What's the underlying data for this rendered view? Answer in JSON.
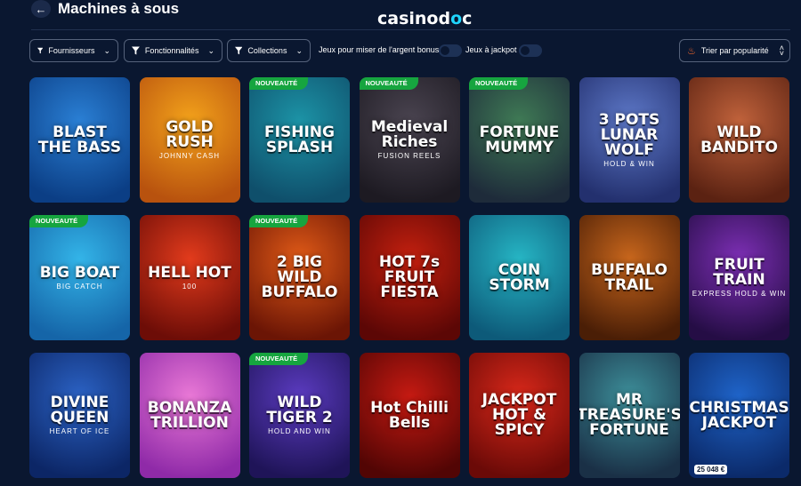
{
  "header": {
    "back_icon": "arrow-left-icon",
    "title": "Machines à sous",
    "logo_prefix": "casinod",
    "logo_o": "o",
    "logo_suffix": "c"
  },
  "filters": {
    "providers": "Fournisseurs",
    "features": "Fonctionnalités",
    "collections": "Collections",
    "bonus_toggle_label": "Jeux pour miser de l'argent bonus",
    "jackpot_toggle_label": "Jeux à jackpot",
    "sort_label": "Trier par popularité"
  },
  "badge_new": "NOUVEAUTÉ",
  "games": [
    {
      "title": "BLAST THE BASS",
      "sub": "",
      "isNew": false,
      "colors": [
        "#2a7fd4",
        "#0b3e85"
      ]
    },
    {
      "title": "GOLD RUSH",
      "sub": "JOHNNY CASH",
      "isNew": false,
      "colors": [
        "#f3a21b",
        "#b8520e"
      ]
    },
    {
      "title": "FISHING SPLASH",
      "sub": "",
      "isNew": true,
      "colors": [
        "#1c93a6",
        "#0f4f6b"
      ]
    },
    {
      "title": "Medieval Riches",
      "sub": "FUSION REELS",
      "isNew": true,
      "colors": [
        "#4a4450",
        "#1d1a22"
      ]
    },
    {
      "title": "FORTUNE MUMMY",
      "sub": "",
      "isNew": true,
      "colors": [
        "#3f7a55",
        "#1e2b3a"
      ]
    },
    {
      "title": "3 POTS LUNAR WOLF",
      "sub": "HOLD & WIN",
      "isNew": false,
      "colors": [
        "#5e79c9",
        "#23306e"
      ]
    },
    {
      "title": "WILD BANDITO",
      "sub": "",
      "isNew": false,
      "colors": [
        "#c0623b",
        "#5b2212"
      ]
    },
    {
      "title": "BIG BOAT",
      "sub": "BIG CATCH",
      "isNew": true,
      "colors": [
        "#33b4e8",
        "#1565a8"
      ]
    },
    {
      "title": "HELL HOT",
      "sub": "100",
      "isNew": false,
      "colors": [
        "#e23b1c",
        "#6d0d07"
      ]
    },
    {
      "title": "2 BIG WILD BUFFALO",
      "sub": "",
      "isNew": true,
      "colors": [
        "#e05a17",
        "#6b1505"
      ]
    },
    {
      "title": "HOT 7s FRUIT FIESTA",
      "sub": "",
      "isNew": false,
      "colors": [
        "#c4200f",
        "#5c0705"
      ]
    },
    {
      "title": "COIN STORM",
      "sub": "",
      "isNew": false,
      "colors": [
        "#26b5c4",
        "#0d5a79"
      ]
    },
    {
      "title": "BUFFALO TRAIL",
      "sub": "",
      "isNew": false,
      "colors": [
        "#c8661c",
        "#4a1e06"
      ]
    },
    {
      "title": "FRUIT TRAIN",
      "sub": "EXPRESS HOLD & WIN",
      "isNew": false,
      "colors": [
        "#7d2fb5",
        "#250d45"
      ]
    },
    {
      "title": "DIVINE QUEEN",
      "sub": "HEART OF ICE",
      "isNew": false,
      "colors": [
        "#2b62c4",
        "#0c2666"
      ]
    },
    {
      "title": "BONANZA TRILLION",
      "sub": "",
      "isNew": false,
      "colors": [
        "#e978d6",
        "#8f2aa8"
      ]
    },
    {
      "title": "WILD TIGER 2",
      "sub": "HOLD AND WIN",
      "isNew": true,
      "colors": [
        "#5b3bc0",
        "#1f1458"
      ]
    },
    {
      "title": "Hot Chilli Bells",
      "sub": "",
      "isNew": false,
      "colors": [
        "#c51a12",
        "#520504"
      ]
    },
    {
      "title": "JACKPOT HOT & SPICY",
      "sub": "",
      "isNew": false,
      "colors": [
        "#d9281a",
        "#6b0a07"
      ]
    },
    {
      "title": "MR TREASURE'S FORTUNE",
      "sub": "",
      "isNew": false,
      "colors": [
        "#3d8f9a",
        "#1a3046"
      ]
    },
    {
      "title": "CHRISTMAS JACKPOT",
      "sub": "",
      "isNew": false,
      "colors": [
        "#1f64c9",
        "#0b2a6a"
      ],
      "jackpot": "25 048 €"
    }
  ]
}
